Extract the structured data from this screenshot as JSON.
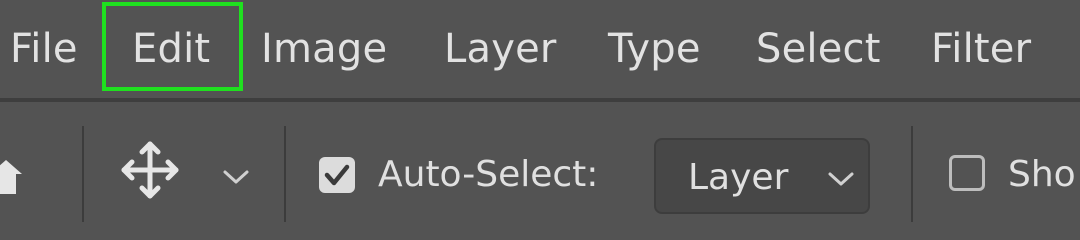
{
  "menubar": {
    "items": [
      "File",
      "Edit",
      "Image",
      "Layer",
      "Type",
      "Select",
      "Filter"
    ],
    "highlighted": "Edit",
    "highlight_color": "#1fe01f"
  },
  "options": {
    "tool_icon": "move-icon",
    "auto_select": {
      "checked": true,
      "label": "Auto-Select:"
    },
    "auto_select_target": {
      "value": "Layer"
    },
    "show_transform": {
      "checked": false,
      "label": "Sho"
    }
  },
  "colors": {
    "background": "#535353",
    "dropdown_bg": "#474747",
    "divider": "#3c3c3c"
  }
}
